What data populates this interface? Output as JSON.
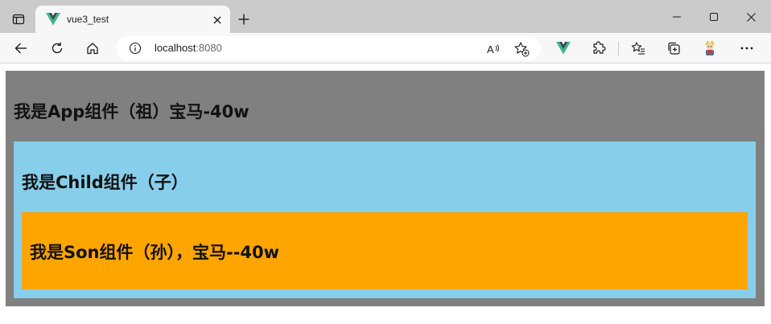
{
  "browser": {
    "tab": {
      "title": "vue3_test",
      "favicon": "vue-logo-icon"
    },
    "address": {
      "host": "localhost",
      "port": ":8080"
    },
    "toolbar_icons": [
      "back-icon",
      "refresh-icon",
      "home-icon",
      "info-icon",
      "read-aloud-icon",
      "add-favorite-icon",
      "vue-devtools-icon",
      "extensions-icon",
      "favorites-icon",
      "collections-icon",
      "profile-avatar-icon",
      "more-icon"
    ],
    "colors": {
      "titlebar": "#cbcbcb",
      "toolbar": "#f7f7f7",
      "vue_green": "#42b883",
      "vue_dark": "#35495e"
    }
  },
  "page": {
    "app": {
      "heading": "我是App组件（祖）宝马-40w",
      "bg": "#808080"
    },
    "child": {
      "heading": "我是Child组件（子）",
      "bg": "#87ceeb"
    },
    "son": {
      "heading": "我是Son组件（孙），宝马--40w",
      "bg": "#ffa500"
    }
  }
}
